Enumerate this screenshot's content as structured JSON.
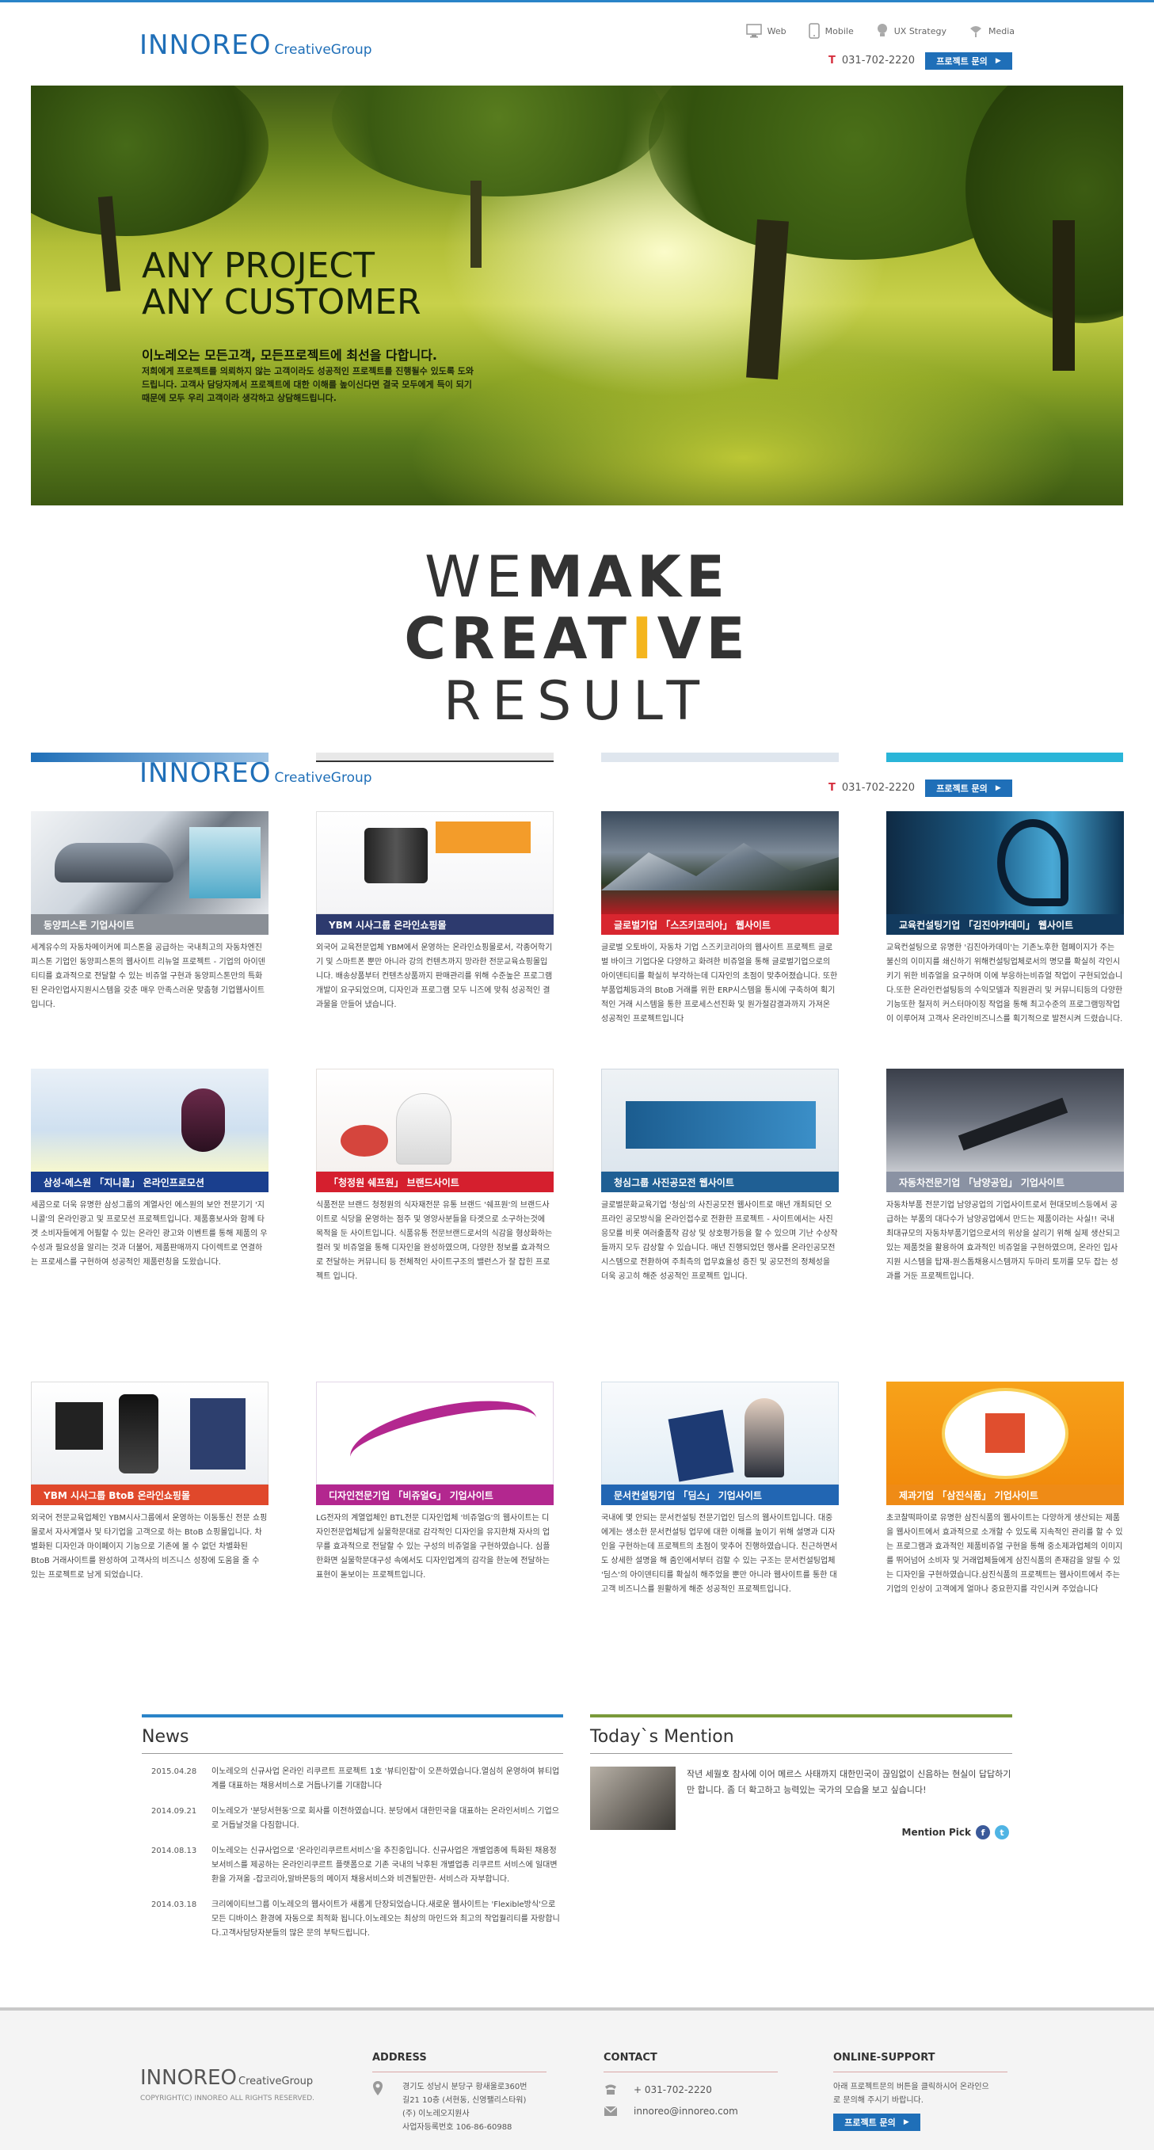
{
  "header": {
    "logo_big": "INNOREO",
    "logo_small": "CreativeGroup",
    "nav": [
      {
        "label": "Web",
        "icon": "monitor-icon"
      },
      {
        "label": "Mobile",
        "icon": "mobile-icon"
      },
      {
        "label": "UX Strategy",
        "icon": "bulb-icon"
      },
      {
        "label": "Media",
        "icon": "satellite-icon"
      }
    ],
    "phone_prefix": "T",
    "phone": "031-702-2220",
    "ask_button": "프로젝트 문의"
  },
  "hero": {
    "title_line1": "ANY PROJECT",
    "title_line2": "ANY CUSTOMER",
    "subtitle": "이노레오는 모든고객, 모든프로젝트에 최선을 다합니다.",
    "text": "저희에게 프로젝트를 의뢰하지 않는 고객이라도 성공적인 프로젝트를 진행될수 있도록 도와드립니다. 고객사 담당자께서 프로젝트에 대한 이해를 높이신다면 결국 모두에게 득이 되기 때문에 모두 우리 고객이라 생각하고 상담해드립니다."
  },
  "slogan": {
    "line1_light": "WE",
    "line1_bold": "MAKE",
    "line2_a": "CREAT",
    "line2_accent": "I",
    "line2_b": "VE",
    "line3": "RESULT"
  },
  "cards": [
    {
      "title": "동양피스톤 기업사이트",
      "color": "#8a8f96",
      "desc": "세계유수의 자동차메이커에 피스톤을 공급하는 국내최고의 자동차엔진피스톤 기업인 동양피스톤의 웹사이트 리뉴얼 프로젝트 - 기업의 아이덴티티를 효과적으로 전달할 수 있는 비쥬얼 구현과 동양피스톤만의 특화된 온라인업사지원시스템을 갖춘 매우 만족스러운 맞춤형 기업웹사이트입니다."
    },
    {
      "title": "YBM 시사그룹 온라인쇼핑몰",
      "color": "#2d3a6e",
      "desc": "외국어 교육전문업체 YBM에서 운영하는 온라인쇼핑몰로서, 각종어학기기 및 스마트폰 뿐만 아니라 강의 컨텐츠까지 망라한 전문교육쇼핑몰입니다. 배송상품부터 컨텐츠상품까지 판매관리를 위해 수준높은 프로그램개발이 요구되었으며, 디자인과 프로그램 모두 니즈에 맞춰 성공적인 결과물을 만들어 냈습니다."
    },
    {
      "title": "글로벌기업 「스즈키코리아」 웹사이트",
      "color": "#d8262f",
      "desc": "글로벌 오토바이, 자동차 기업 스즈키코리아의 웹사이트 프로젝트 글로벌 바이크 기업다운 다양하고 화려한 비쥬얼을 통해 글로벌기업으로의 아이덴티티를 확실히 부각하는데 디자인의 초점이 맞추어졌습니다. 또한 부품업체등과의 BtoB 거래를 위한 ERP시스템을 통시에 구축하여 획기적인 거래 시스템을 통한 프로세스선진화 및 원가절감결과까지 가져온 성공적인 프로젝트입니다"
    },
    {
      "title": "교육컨설팅기업 「김진아카데미」 웹사이트",
      "color": "#123a5e",
      "desc": "교육컨설팅으로 유명한 '김진아카데미'는 기존노후한 협페이지가 주는 불신의 이미지를 쇄신하기 위해컨설팅업체로서의 명모를 확실히 각인시키기 위한 비쥬얼을 요구하며 이에 부응하는비쥬얼 작업이 구현되었습니다.또한 온라인컨설팅등의 수익모델과 직원관리 및 커뮤니티등의 다양한기능또한 철저히 커스터마이징 작업을 통해 최고수준의 프로그램밍작업이 이루어져 고객사 온라인비즈니스를 획기적으로 발전시켜 드렸습니다."
    },
    {
      "title": "삼성-에스원 「지니콜」 온라인프로모션",
      "color": "#1a3f8e",
      "desc": "세콤으로 더욱 유명한 삼성그룹의 계열사인 에스원의 보안 전문기기 '지니콜'의 온라인광고 및 프로모션 프로젝트입니다. 제품홍보사와 함께 타겟 소비자들에게 어필할 수 있는 온라인 광고와 이벤트를 통해 제품의 우수성과 필요성을 알리는 것과 더불어, 제품판매까지 다이렉트로 연결하는 프로세스를 구현하여 성공적인 제품런칭을 도왔습니다."
    },
    {
      "title": "「청정원 쉐프원」 브랜드사이트",
      "color": "#d51f2e",
      "desc": "식품전문 브랜드 청정원의 식자재전문 유통 브랜드 '쉐프원'의 브랜드사이트로 식당을 운영하는 점주 및 영양사분들을 타겟으로 소구하는것에 목적을 둔 사이트입니다. 식품유통 전문브랜드로서의 식감을 형상화하는 컬러 및 비쥬얼을 통해 디자인을 완성하였으며, 다양한 정보를 효과적으로 전달하는 커뮤니티 등 전체적인 사이트구조의 밸런스가 잘 잡힌 프로젝트 입니다."
    },
    {
      "title": "청심그룹 사진공모전 웹사이트",
      "color": "#1f5f94",
      "desc": "글로벌문화교육기업 '청심'의 사진공모전 웹사이트로 매년 개최되던 오프라인 공모방식을 온라인접수로 전환한 프로젝트 - 사이트에서는 사진응모를 비롯 여러출품작 감상 및 상호평가등을 할 수 있으며 기난 수상작들까지 모두 감상할 수 있습니다. 매년 진행되었던 행사를 온라인공모전 시스템으로 전환하여 주최측의 업무효율성 증진 및 공모전의 정체성을 더욱 공고히 해준 성공적인 프로젝트 입니다."
    },
    {
      "title": "자동차전문기업 「남양공업」 기업사이트",
      "color": "#8a92a3",
      "desc": "자동차부품 전문기업 남양공업의 기업사이트로서 현대모비스등에서 공급하는 부품의 대다수가 남양공업에서 만드는 제품이라는 사실!! 국내 최대규모의 자동차부품기업으로서의 위상을 살리기 위해 실제 생산되고 있는 제품컷을 활용하여 효과적인 비쥬얼을 구현하였으며, 온라인 입사지원 시스템을 탑재-원스톱채용시스템까지 두마리 토끼를 모두 잡는 성과를 거둔 프로젝트입니다."
    },
    {
      "title": "YBM 시사그룹 BtoB 온라인쇼핑몰",
      "color": "#e0482b",
      "desc": "외국어 전문교육업체인 YBM시사그룹에서 운영하는 이동통신 전문 쇼핑몰로서 자사계열사 및 타기업을 고객으로 하는 BtoB 쇼핑몰입니다. 차별화된 디자인과 마이페이지 기능으로 기존에 볼 수 없던 차별화된 BtoB 거래사이트를 완성하여 고객사의 비즈니스 성장에 도움을 줄 수 있는 프로젝트로 남게 되었습니다."
    },
    {
      "title": "디자인전문기업 「비쥬얼G」 기업사이트",
      "color": "#b3278f",
      "desc": "LG전자의 계열업체인 BTL전문 디자인업체 '비쥬얼G'의 웹사이트는 디자인전문업체답게 실물학문대로 감각적인 디자인을 유지한채 자사의 업무를 효과적으로 전달할 수 있는 구성의 비쥬얼을 구현하였습니다. 심플한화면 실물학문대구성 속에서도 디자인업계의 감각을 한눈에 전달하는표현이 돋보이는 프로젝트입니다."
    },
    {
      "title": "문서컨설팅기업 「딤스」 기업사이트",
      "color": "#2266b3",
      "desc": "국내에 몇 안되는 문서컨설팅 전문기업인 딤스의 웹사이트입니다. 대중에게는 생소한 문서컨설팅 업무에 대한 이해를 높이기 위해 설명과 디자인을 구현하는데 프로젝트의 초점이 맞추어 진행하였습니다. 친근하면서도 상세한 설명을 해 줌인에서부터 검할 수 있는 구조는 문서컨설팅업체 '딤스'의 아이덴티티를 확실히 해주었을 뿐만 아니라 웹사이트를 통한 대고객 비즈니스를 원활하게 해준 성공적인 프로젝트입니다."
    },
    {
      "title": "제과기업 「삼진식품」 기업사이트",
      "color": "#ef8b16",
      "desc": "초코찰떡파이로 유명한 삼진식품의 웹사이트는 다양하게 생산되는 제품을 웹사이트에서 효과적으로 소개할 수 있도록 지속적인 관리를 할 수 있는 프로그램과 효과적인 제품비쥬얼 구현을 통해 중소제과업체의 이미지를 뛰어넘어 소비자 및 거래업체들에게 삼진식품의 존재감을 알릴 수 있는 디자인을 구현하였습니다.삼진식품의 프로젝트는 웹사이트에서 주는 기업의 인상이 고객에게 얼마나 중요한지를 각인시켜 주었습니다"
    }
  ],
  "news": {
    "title": "News",
    "items": [
      {
        "date": "2015.04.28",
        "text": "이노레오의 신규사업 온라인 리쿠르트 프로젝트 1호 '뷰티인잡'이 오픈하였습니다.열심히 운영하여 뷰티업계를 대표하는 채용서비스로 거듭나기를 기대합니다"
      },
      {
        "date": "2014.09.21",
        "text": "이노레오가 '분당서현동'으로 회사를 이전하였습니다. 분당에서 대한민국을 대표하는 온라인서비스 기업으로 거듭날것을 다짐합니다."
      },
      {
        "date": "2014.08.13",
        "text": "이노레오는 신규사업으로 '온라인리쿠르트서비스'을 추진중입니다. 신규사업은 개별업종에 특화된 채용정보서비스를 제공하는 온라인리쿠르트 플랫폼으로 기존 국내의 낙후된 개별업종 리쿠르트 서비스에 일대변환을 가져올 -잡코리아,알바몬등의 메이저 채용서비스와 비견될만한- 서비스라 자부합니다."
      },
      {
        "date": "2014.03.18",
        "text": "크리에이티브그룹 이노레오의 웹사이트가 새롭게 단장되었습니다.새로운 웹사이트는 'Flexible방식'으로 모든 디바이스 환경에 자동으로 최적화 됩니다.이노레오는 최상의 마인드와 최고의 작업퀄리티를 자랑합니다.고객사담당자분들의 많은 문의 부탁드립니다."
      }
    ]
  },
  "mention": {
    "title": "Today`s Mention",
    "text": "작년 세월호 참사에 이어 메르스 사태까지 대한민국이 끊임없이 신음하는 현실이 답답하기만 합니다. 좀 더 확고하고 능력있는 국가의 모습을 보고 싶습니다!",
    "pick_label": "Mention Pick",
    "icons": [
      "facebook-icon",
      "twitter-icon"
    ]
  },
  "footer": {
    "logo_big": "INNOREO",
    "logo_small": "CreativeGroup",
    "copyright": "COPYRIGHT(C) INNOREO ALL RIGHTS RESERVED.",
    "address_title": "ADDRESS",
    "address_lines": [
      "경기도 성남시 분당구 황새울로360번",
      "길21 10층 (서현동, 신영팰리스타워)",
      "(주) 이노레오지원사",
      "사업자등록번호 106-86-60988"
    ],
    "contact_title": "CONTACT",
    "contact_phone": "+ 031-702-2220",
    "contact_email": "innoreo@innoreo.com",
    "support_title": "ONLINE-SUPPORT",
    "support_text": "아래 프로젝트문의 버튼을 클릭하시어 온라인으로 문의해 주시기 바랍니다.",
    "support_button": "프로젝트 문의"
  },
  "colors": {
    "brand": "#1f6fb8",
    "accent": "#f4b51e",
    "phone_red": "#d52e3d"
  }
}
